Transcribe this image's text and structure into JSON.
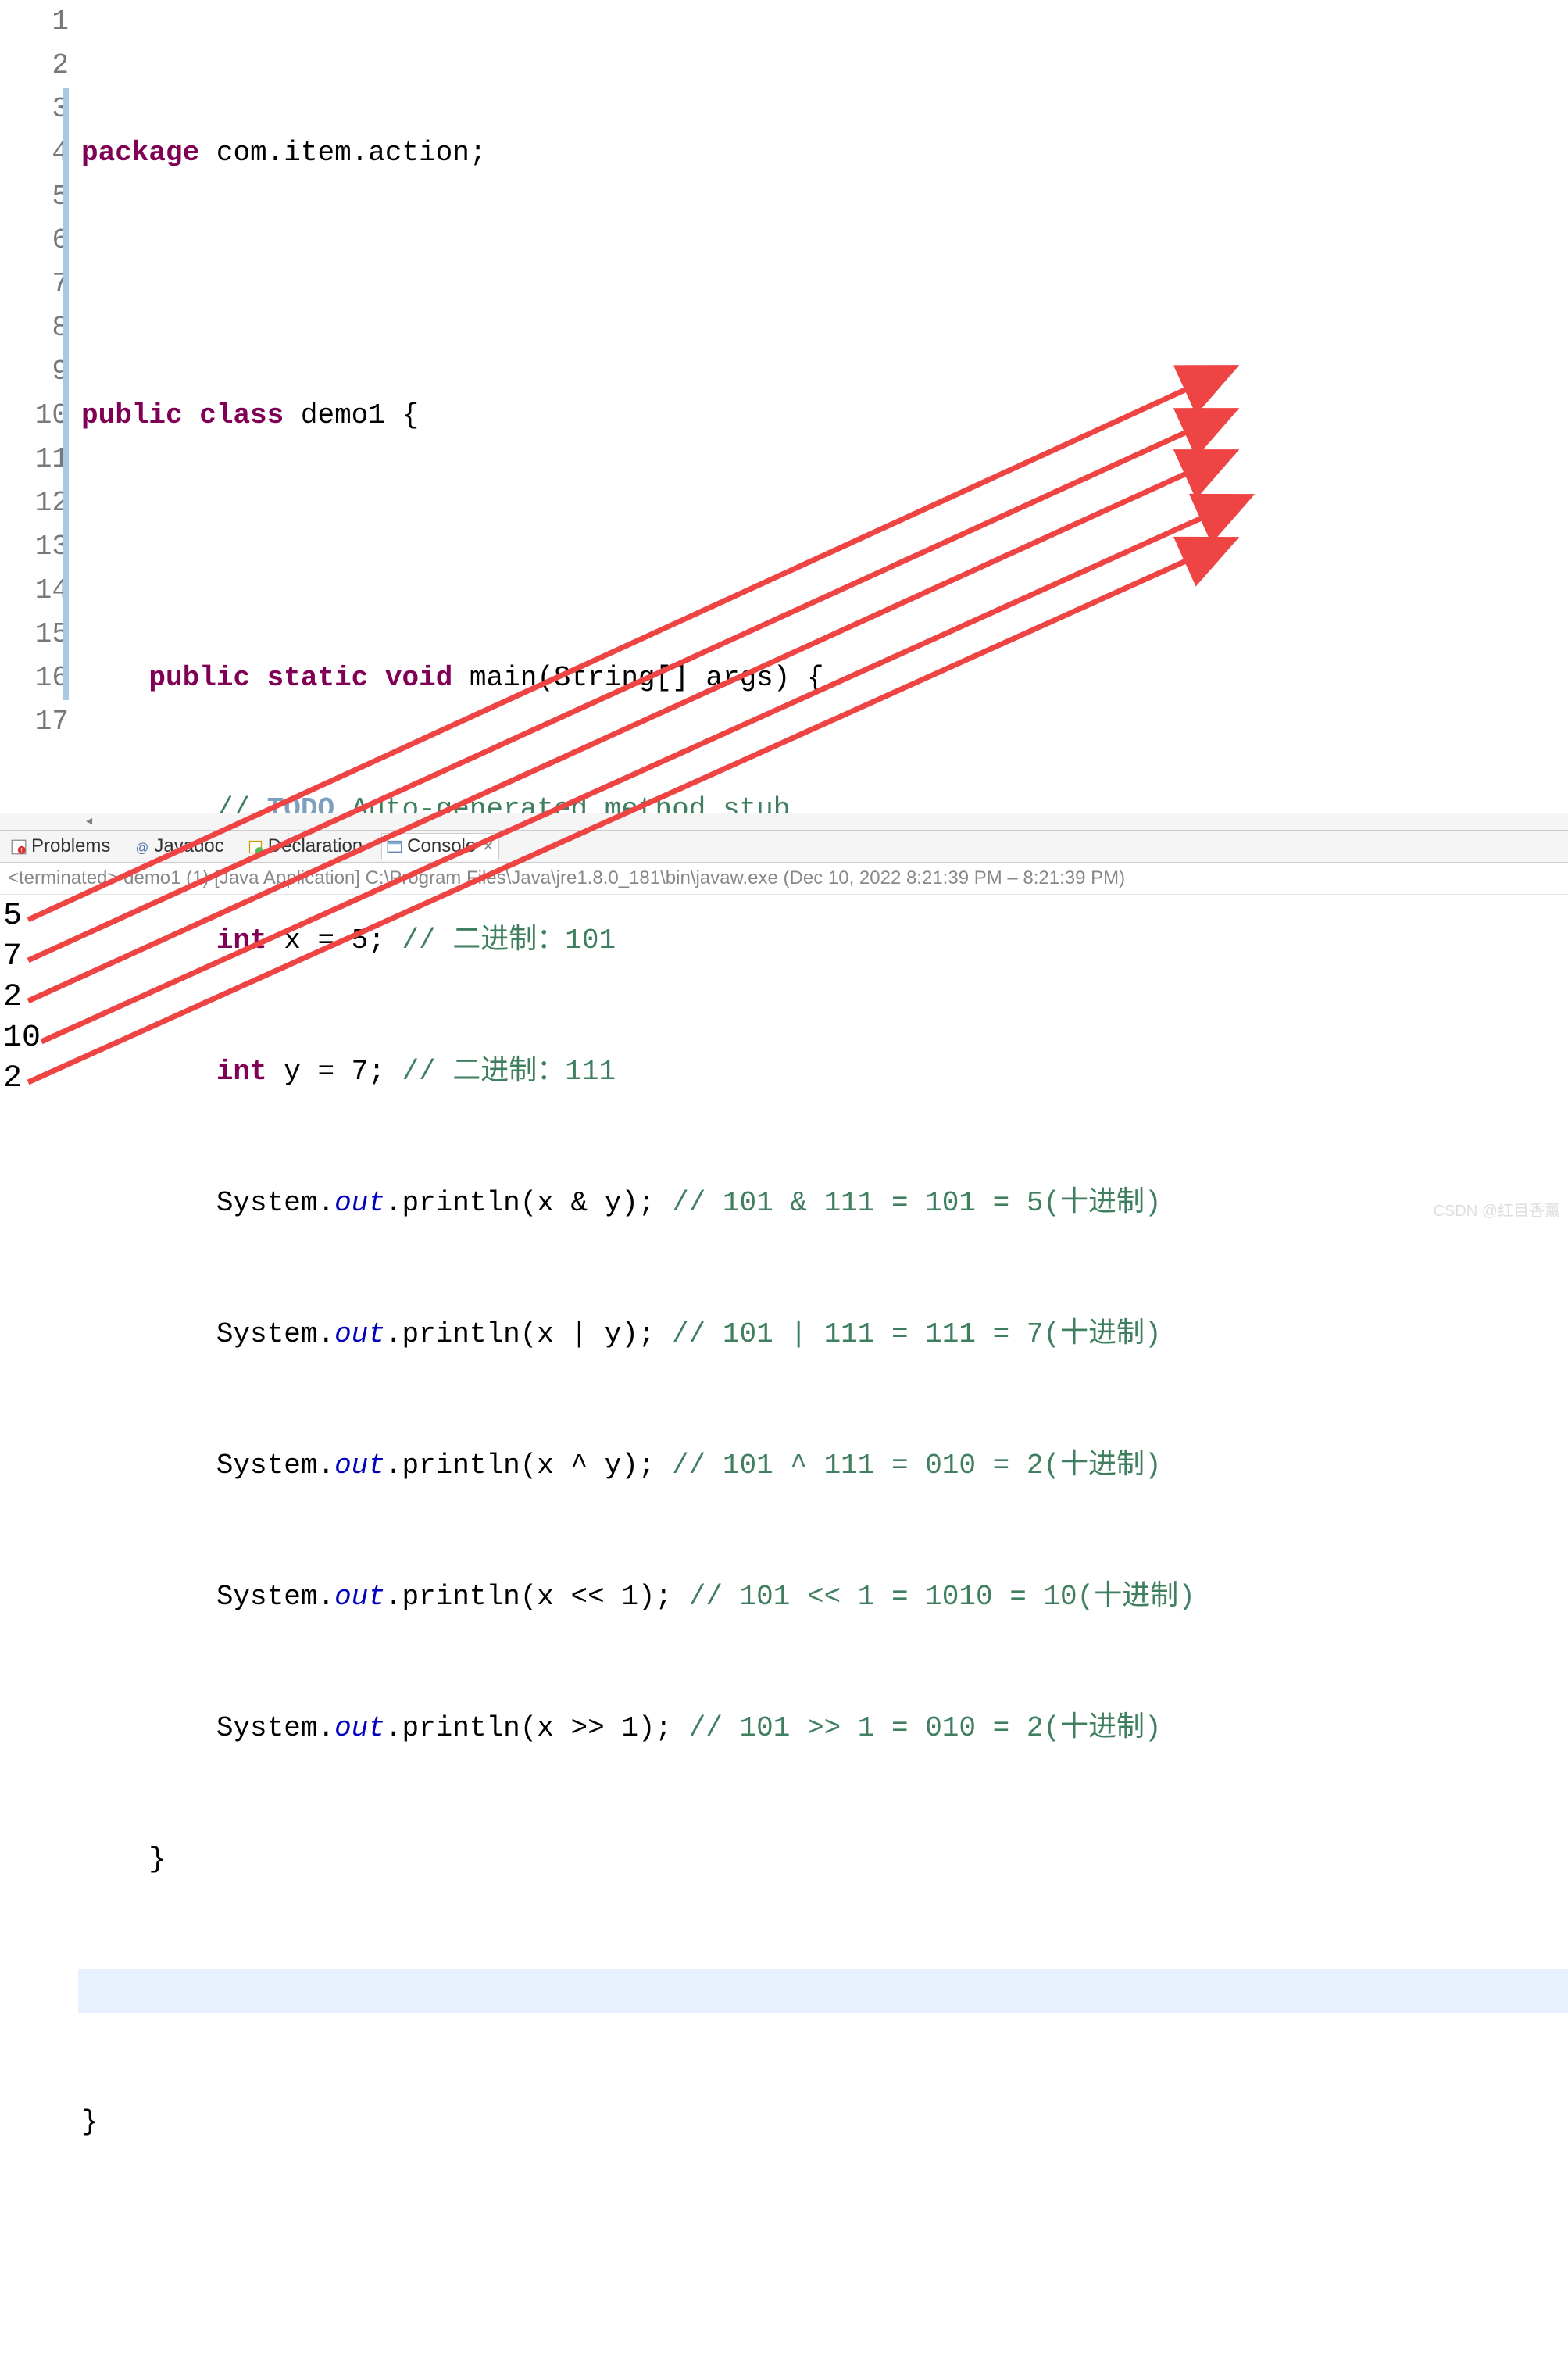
{
  "gutter": [
    "1",
    "2",
    "3",
    "4",
    "5",
    "6",
    "7",
    "8",
    "9",
    "10",
    "11",
    "12",
    "13",
    "14",
    "15",
    "16",
    "17"
  ],
  "code": {
    "l1": {
      "kw": "package",
      "pkg": " com.item.action;"
    },
    "l3": {
      "kw1": "public",
      "kw2": "class",
      "name": " demo1 {"
    },
    "l5": {
      "kw1": "public",
      "kw2": "static",
      "kw3": "void",
      "sig": " main(String[] args) {"
    },
    "l6": {
      "c1": "// ",
      "todo": "TODO",
      "c2": " Auto-generated method stub"
    },
    "l7": {
      "kw": "int",
      "body": " x = 5; ",
      "c": "// 二进制：101"
    },
    "l8": {
      "kw": "int",
      "body": " y = 7; ",
      "c": "// 二进制：111"
    },
    "l9": {
      "a": "System.",
      "out": "out",
      "b": ".println(x & y); ",
      "c": "// 101 & 111 = 101 = 5(十进制)"
    },
    "l10": {
      "a": "System.",
      "out": "out",
      "b": ".println(x | y); ",
      "c": "// 101 | 111 = 111 = 7(十进制)"
    },
    "l11": {
      "a": "System.",
      "out": "out",
      "b": ".println(x ^ y); ",
      "c": "// 101 ^ 111 = 010 = 2(十进制)"
    },
    "l12": {
      "a": "System.",
      "out": "out",
      "b": ".println(x << 1); ",
      "c": "// 101 << 1 = 1010 = 10(十进制)"
    },
    "l13": {
      "a": "System.",
      "out": "out",
      "b": ".println(x >> 1); ",
      "c": "// 101 >> 1 = 010 = 2(十进制)"
    },
    "l14": "    }",
    "l16": "}"
  },
  "tabs": {
    "problems": "Problems",
    "javadoc": "Javadoc",
    "declaration": "Declaration",
    "console": "Console"
  },
  "console": {
    "header": "<terminated> demo1 (1) [Java Application] C:\\Program Files\\Java\\jre1.8.0_181\\bin\\javaw.exe  (Dec 10, 2022 8:21:39 PM – 8:21:39 PM)",
    "out": [
      "5",
      "7",
      "2",
      "10",
      "2"
    ]
  },
  "watermark": "CSDN @红目香薰"
}
